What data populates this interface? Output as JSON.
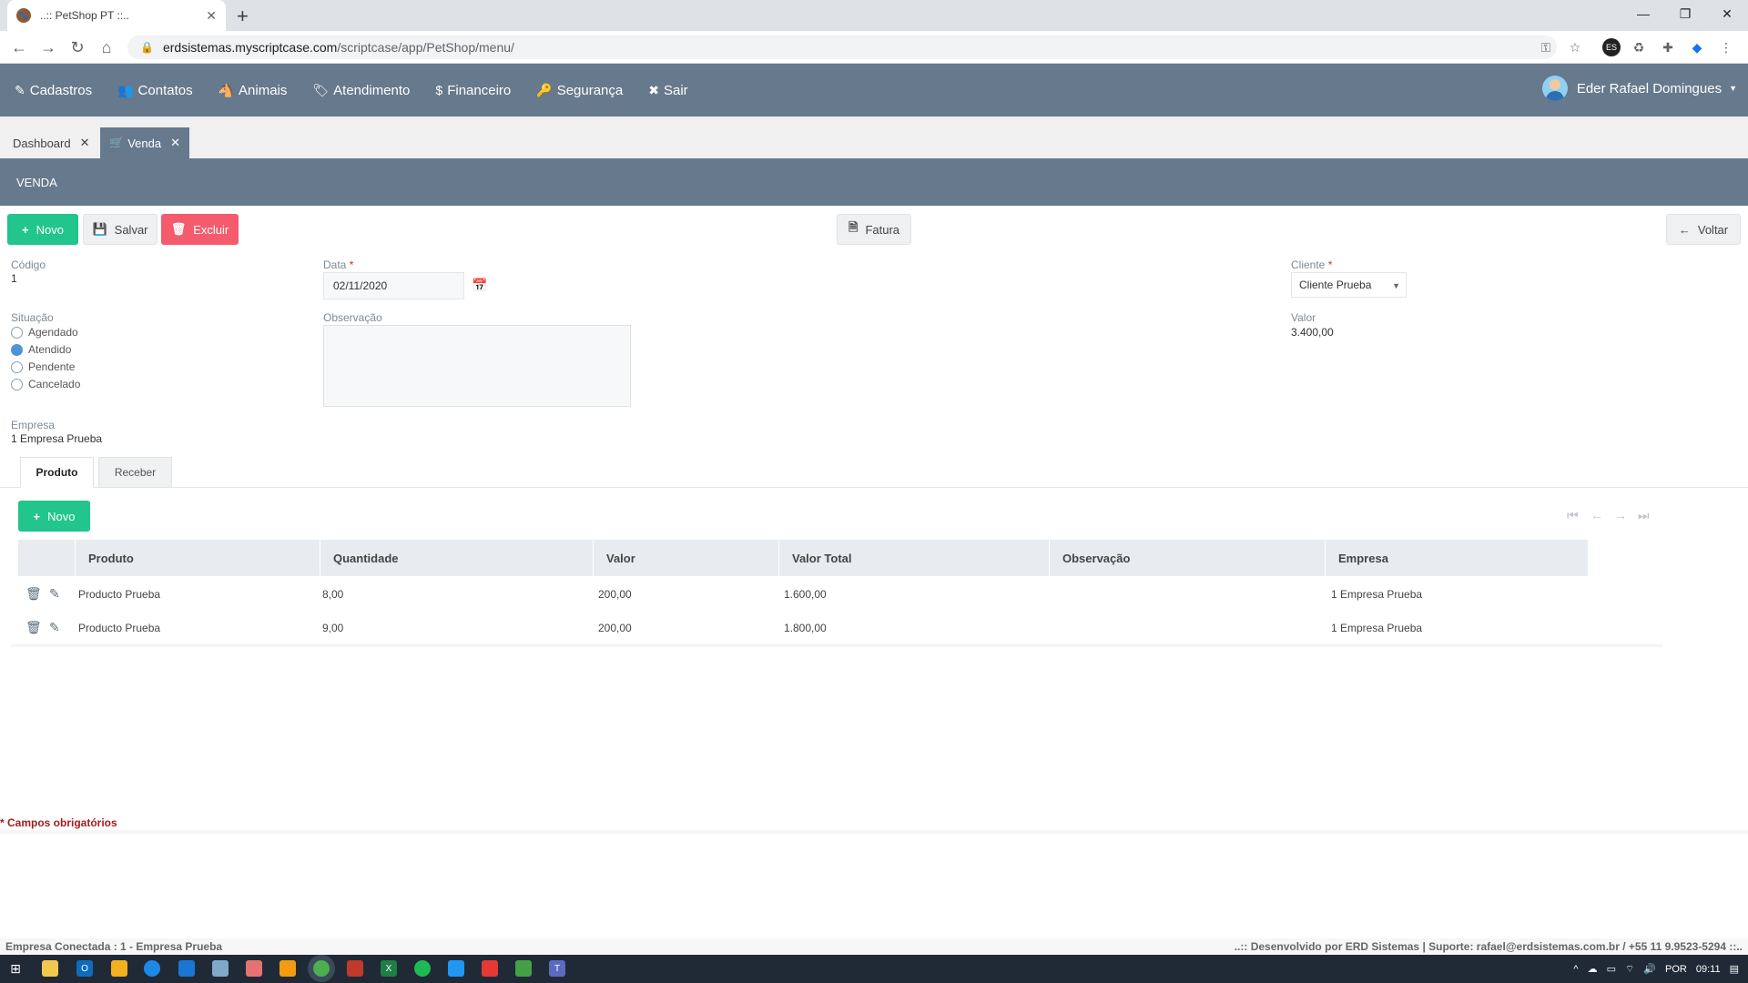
{
  "browser": {
    "tab_title": "..:: PetShop PT ::..",
    "tab_close": "✕",
    "new_tab": "+",
    "url_host": "erdsistemas.myscriptcase.com",
    "url_path": "/scriptcase/app/PetShop/menu/",
    "window_controls": [
      "—",
      "❐",
      "✕"
    ]
  },
  "menu": {
    "items": [
      {
        "icon": "edit-icon",
        "glyph": "✎",
        "label": "Cadastros"
      },
      {
        "icon": "users-icon",
        "glyph": "👥",
        "label": "Contatos"
      },
      {
        "icon": "horse-icon",
        "glyph": "🐴",
        "label": "Animais"
      },
      {
        "icon": "tags-icon",
        "glyph": "🏷",
        "label": "Atendimento"
      },
      {
        "icon": "dollar-icon",
        "glyph": "$",
        "label": "Financeiro"
      },
      {
        "icon": "key-icon",
        "glyph": "🔑",
        "label": "Segurança"
      },
      {
        "icon": "times-circle-icon",
        "glyph": "✖",
        "label": "Sair"
      }
    ],
    "user_name": "Eder Rafael Domingues",
    "user_caret": "▼"
  },
  "app_tabs": [
    {
      "label": "Dashboard",
      "close": "✕"
    },
    {
      "label": "Venda",
      "close": "✕"
    }
  ],
  "page_title": "VENDA",
  "toolbar": {
    "novo": "Novo",
    "salvar": "Salvar",
    "excluir": "Excluir",
    "fatura": "Fatura",
    "voltar": "Voltar"
  },
  "form": {
    "codigo_label": "Código",
    "codigo_value": "1",
    "data_label": "Data",
    "data_value": "02/11/2020",
    "required_mark": "*",
    "cliente_label": "Cliente",
    "cliente_value": "Cliente Prueba",
    "situacao_label": "Situação",
    "situacao_options": [
      "Agendado",
      "Atendido",
      "Pendente",
      "Cancelado"
    ],
    "situacao_selected": "Atendido",
    "observacao_label": "Observação",
    "valor_label": "Valor",
    "valor_value": "3.400,00",
    "empresa_label": "Empresa",
    "empresa_value": "1 Empresa Prueba"
  },
  "subtabs": [
    "Produto",
    "Receber"
  ],
  "grid": {
    "novo": "Novo",
    "columns": [
      "Produto",
      "Quantidade",
      "Valor",
      "Valor Total",
      "Observação",
      "Empresa"
    ],
    "rows": [
      {
        "produto": "Producto Prueba",
        "quantidade": "8,00",
        "valor": "200,00",
        "valor_total": "1.600,00",
        "observacao": "",
        "empresa": "1 Empresa Prueba"
      },
      {
        "produto": "Producto Prueba",
        "quantidade": "9,00",
        "valor": "200,00",
        "valor_total": "1.800,00",
        "observacao": "",
        "empresa": "1 Empresa Prueba"
      }
    ]
  },
  "required_note": "* Campos obrigatórios",
  "footer": {
    "left": "Empresa Conectada : 1 - Empresa Prueba",
    "right": "..:: Desenvolvido por ERD Sistemas | Suporte: rafael@erdsistemas.com.br / +55 11 9.9523-5294 ::.."
  },
  "taskbar": {
    "language": "POR",
    "time": "09:11"
  },
  "colors": {
    "menu_bg": "#67798d",
    "green": "#22c58b",
    "red": "#f45b6d"
  }
}
